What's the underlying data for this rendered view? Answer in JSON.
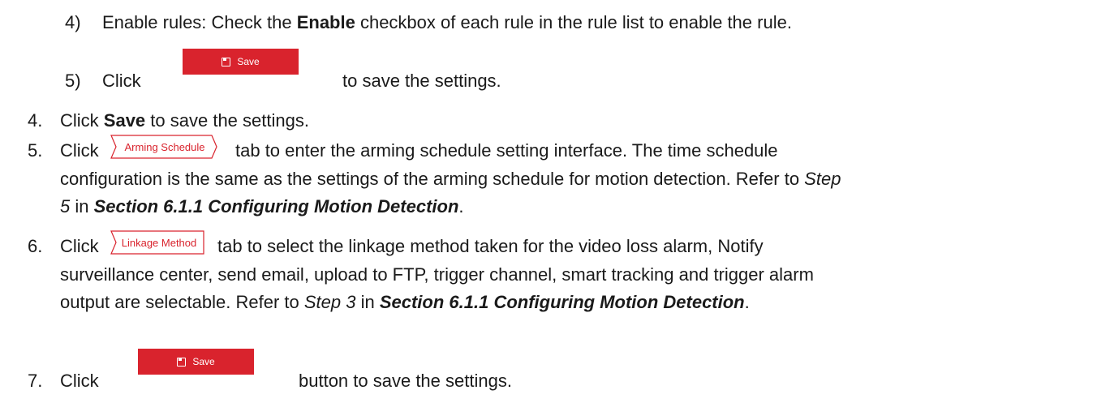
{
  "steps": {
    "s4_sub": {
      "num": "4)",
      "t1": "Enable rules: Check the ",
      "bold": "Enable",
      "t2": " checkbox of each rule in the rule list to enable the rule."
    },
    "s5_sub": {
      "num": "5)",
      "t1": "Click",
      "t2": "to save the settings."
    },
    "s4": {
      "num": "4.",
      "t1": "Click ",
      "bold": "Save",
      "t2": " to save the settings."
    },
    "s5": {
      "num": "5.",
      "t1": "Click",
      "t2": "tab to enter the arming schedule setting interface. The time schedule",
      "l2": "configuration is the same as the settings of the arming schedule for motion detection. Refer to ",
      "l2_it": "Step",
      "l3_it": "5",
      "l3_a": " in ",
      "l3_bi": "Section 6.1.1 Configuring Motion Detection",
      "l3_b": "."
    },
    "s6": {
      "num": "6.",
      "t1": "Click",
      "t2": "tab to select the linkage method taken for the video loss alarm, Notify",
      "l2": "surveillance center, send email, upload to FTP, trigger channel, smart tracking and trigger alarm",
      "l3_a": "output are selectable. Refer to ",
      "l3_it": "Step 3",
      "l3_b": " in ",
      "l3_bi": "Section 6.1.1 Configuring Motion Detection",
      "l3_c": "."
    },
    "s7": {
      "num": "7.",
      "t1": "Click",
      "t2": "button to save the settings."
    }
  },
  "buttons": {
    "save_label": "Save",
    "arming_schedule_tab": "Arming Schedule",
    "linkage_method_tab": "Linkage Method"
  },
  "colors": {
    "save_bg": "#d9232d",
    "tab_border": "#d9232d",
    "tab_text": "#d9232d"
  },
  "icons": {
    "save": "floppy-disk-icon"
  }
}
